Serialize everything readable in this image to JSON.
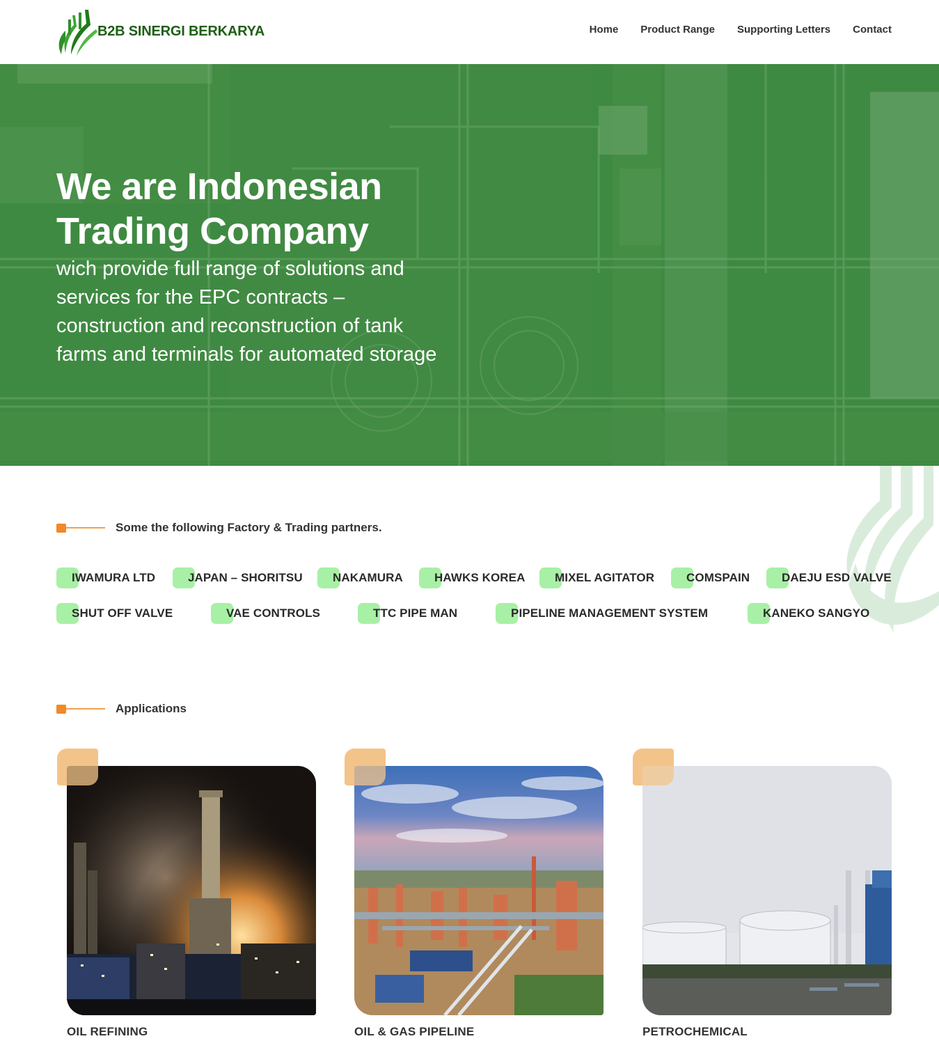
{
  "brand": {
    "name": "B2B SINERGI BERKARYA",
    "color": "#1f5e16"
  },
  "nav": {
    "items": [
      {
        "label": "Home"
      },
      {
        "label": "Product Range"
      },
      {
        "label": "Supporting Letters"
      },
      {
        "label": "Contact"
      }
    ]
  },
  "hero": {
    "title_line1": "We are Indonesian",
    "title_line2": "Trading Company",
    "subtitle_lines": [
      "wich provide full range of solutions and",
      "services for the EPC contracts –",
      "construction and reconstruction of tank",
      "farms and terminals for automated storage"
    ],
    "overlay_color": "#3f8a42"
  },
  "partners": {
    "heading": "Some the following Factory & Trading partners.",
    "row1": [
      "IWAMURA LTD",
      "JAPAN – SHORITSU",
      "NAKAMURA",
      "HAWKS KOREA",
      "MIXEL AGITATOR",
      "COMSPAIN",
      "DAEJU ESD VALVE"
    ],
    "row2": [
      "SHUT OFF VALVE",
      "VAE CONTROLS",
      "TTC PIPE MAN",
      "PIPELINE MANAGEMENT SYSTEM",
      "KANEKO SANGYO"
    ],
    "pill_color": "#a8f0a6"
  },
  "applications": {
    "heading": "Applications",
    "items": [
      {
        "label": "OIL REFINING",
        "image": "refinery-night-photo"
      },
      {
        "label": "OIL & GAS PIPELINE",
        "image": "refinery-aerial-photo"
      },
      {
        "label": "PETROCHEMICAL",
        "image": "storage-tanks-photo"
      }
    ]
  },
  "colors": {
    "accent_orange": "#f0892a",
    "accent_peach": "#f3c48a"
  }
}
